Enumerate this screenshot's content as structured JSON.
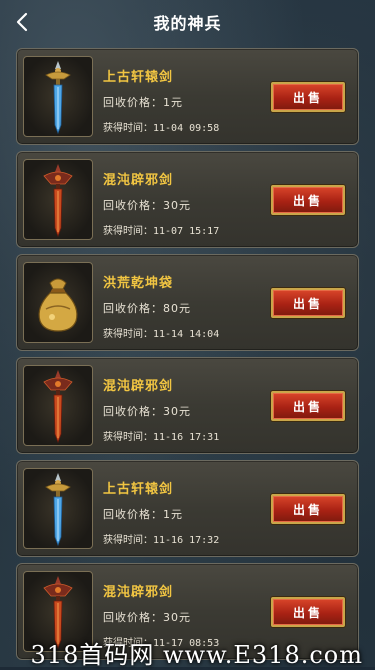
{
  "header": {
    "title": "我的神兵",
    "back_icon": "chevron-left-icon"
  },
  "items": [
    {
      "name": "上古轩辕剑",
      "price": "回收价格：1元",
      "time": "获得时间：11-04 09:58",
      "sell_label": "出售",
      "icon": "blue-sword-icon"
    },
    {
      "name": "混沌辟邪剑",
      "price": "回收价格：30元",
      "time": "获得时间：11-07 15:17",
      "sell_label": "出售",
      "icon": "red-sword-icon"
    },
    {
      "name": "洪荒乾坤袋",
      "price": "回收价格：80元",
      "time": "获得时间：11-14 14:04",
      "sell_label": "出售",
      "icon": "gold-bag-icon"
    },
    {
      "name": "混沌辟邪剑",
      "price": "回收价格：30元",
      "time": "获得时间：11-16 17:31",
      "sell_label": "出售",
      "icon": "red-sword-icon"
    },
    {
      "name": "上古轩辕剑",
      "price": "回收价格：1元",
      "time": "获得时间：11-16 17:32",
      "sell_label": "出售",
      "icon": "blue-sword-icon"
    },
    {
      "name": "混沌辟邪剑",
      "price": "回收价格：30元",
      "time": "获得时间：11-17 08:53",
      "sell_label": "出售",
      "icon": "red-sword-icon"
    }
  ],
  "watermark": "318首码网 www.E318.com"
}
